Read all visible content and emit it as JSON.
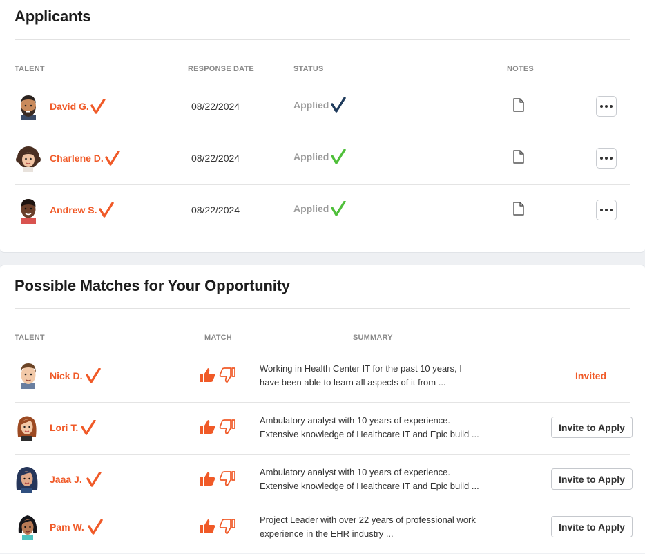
{
  "applicants": {
    "title": "Applicants",
    "columns": {
      "talent": "TALENT",
      "response_date": "RESPONSE DATE",
      "status": "STATUS",
      "notes": "NOTES"
    },
    "rows": [
      {
        "name": "David G.",
        "date": "08/22/2024",
        "status": "Applied",
        "status_check_color": "#1f3b5c",
        "avatar": "avatar-bearded-man"
      },
      {
        "name": "Charlene D.",
        "date": "08/22/2024",
        "status": "Applied",
        "status_check_color": "#4fbf3a",
        "avatar": "avatar-curly-woman"
      },
      {
        "name": "Andrew S.",
        "date": "08/22/2024",
        "status": "Applied",
        "status_check_color": "#4fbf3a",
        "avatar": "avatar-dark-man"
      }
    ]
  },
  "matches": {
    "title": "Possible Matches for Your Opportunity",
    "columns": {
      "talent": "TALENT",
      "match": "MATCH",
      "summary": "SUMMARY"
    },
    "rows": [
      {
        "name": "Nick D.",
        "summary_line1": "Working in Health Center IT for the past 10 years, I",
        "summary_line2": "have been able to learn all aspects of it from ...",
        "action": "Invited"
      },
      {
        "name": "Lori T.",
        "summary_line1": "Ambulatory analyst with 10 years of experience.",
        "summary_line2": "Extensive knowledge of Healthcare IT and Epic build ...",
        "action": "Invite to Apply"
      },
      {
        "name": "Jaaa J.",
        "summary_line1": "Ambulatory analyst with 10 years of experience.",
        "summary_line2": "Extensive knowledge of Healthcare IT and Epic build ...",
        "action": "Invite to Apply"
      },
      {
        "name": "Pam W.",
        "summary_line1": "Project Leader with over 22 years of professional work",
        "summary_line2": "experience in the EHR industry ...",
        "action": "Invite to Apply"
      }
    ]
  },
  "colors": {
    "accent": "#f05a28",
    "check_green": "#4fbf3a",
    "check_navy": "#1f3b5c",
    "muted": "#9a9a9a"
  }
}
